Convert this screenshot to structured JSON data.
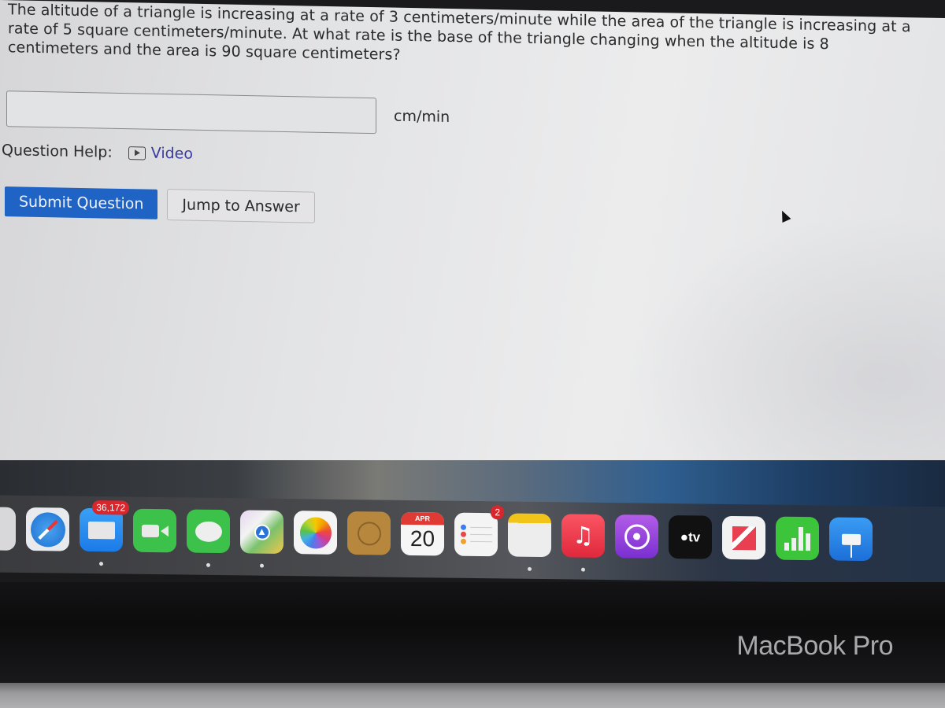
{
  "question": {
    "text": "The altitude of a triangle is increasing at a rate of 3 centimeters/minute while the area of the triangle is increasing at a rate of 5 square centimeters/minute. At what rate is the base of the triangle changing when the altitude is 8 centimeters and the area is 90 square centimeters?"
  },
  "answer": {
    "value": "",
    "placeholder": "",
    "unit": "cm/min"
  },
  "help": {
    "label": "Question Help:",
    "video_label": "Video",
    "video_icon": "play-icon"
  },
  "buttons": {
    "submit": "Submit Question",
    "jump": "Jump to Answer"
  },
  "colors": {
    "submit_bg": "#1f63c4",
    "link": "#3a3aa0"
  },
  "dock": {
    "items": [
      {
        "name": "Launchpad",
        "icon": "launchpad-icon",
        "running": false
      },
      {
        "name": "Safari",
        "icon": "safari-icon",
        "running": false
      },
      {
        "name": "Mail",
        "icon": "mail-icon",
        "badge": "36,172",
        "running": true
      },
      {
        "name": "FaceTime",
        "icon": "facetime-icon",
        "running": false
      },
      {
        "name": "Messages",
        "icon": "messages-icon",
        "running": true
      },
      {
        "name": "Maps",
        "icon": "maps-icon",
        "running": true
      },
      {
        "name": "Photos",
        "icon": "photos-icon",
        "running": false
      },
      {
        "name": "Contacts",
        "icon": "contacts-icon",
        "running": false
      },
      {
        "name": "Calendar",
        "icon": "calendar-icon",
        "month": "APR",
        "day": "20",
        "running": false
      },
      {
        "name": "Reminders",
        "icon": "reminders-icon",
        "badge": "2",
        "running": false
      },
      {
        "name": "Notes",
        "icon": "notes-icon",
        "running": true
      },
      {
        "name": "Music",
        "icon": "music-icon",
        "running": true
      },
      {
        "name": "Podcasts",
        "icon": "podcasts-icon",
        "running": false
      },
      {
        "name": "TV",
        "icon": "tv-icon",
        "label": "tv",
        "running": false
      },
      {
        "name": "News",
        "icon": "news-icon",
        "running": false
      },
      {
        "name": "Numbers",
        "icon": "numbers-icon",
        "running": false
      },
      {
        "name": "Keynote",
        "icon": "keynote-icon",
        "running": false
      }
    ]
  },
  "bezel": {
    "brand": "MacBook Pro"
  }
}
